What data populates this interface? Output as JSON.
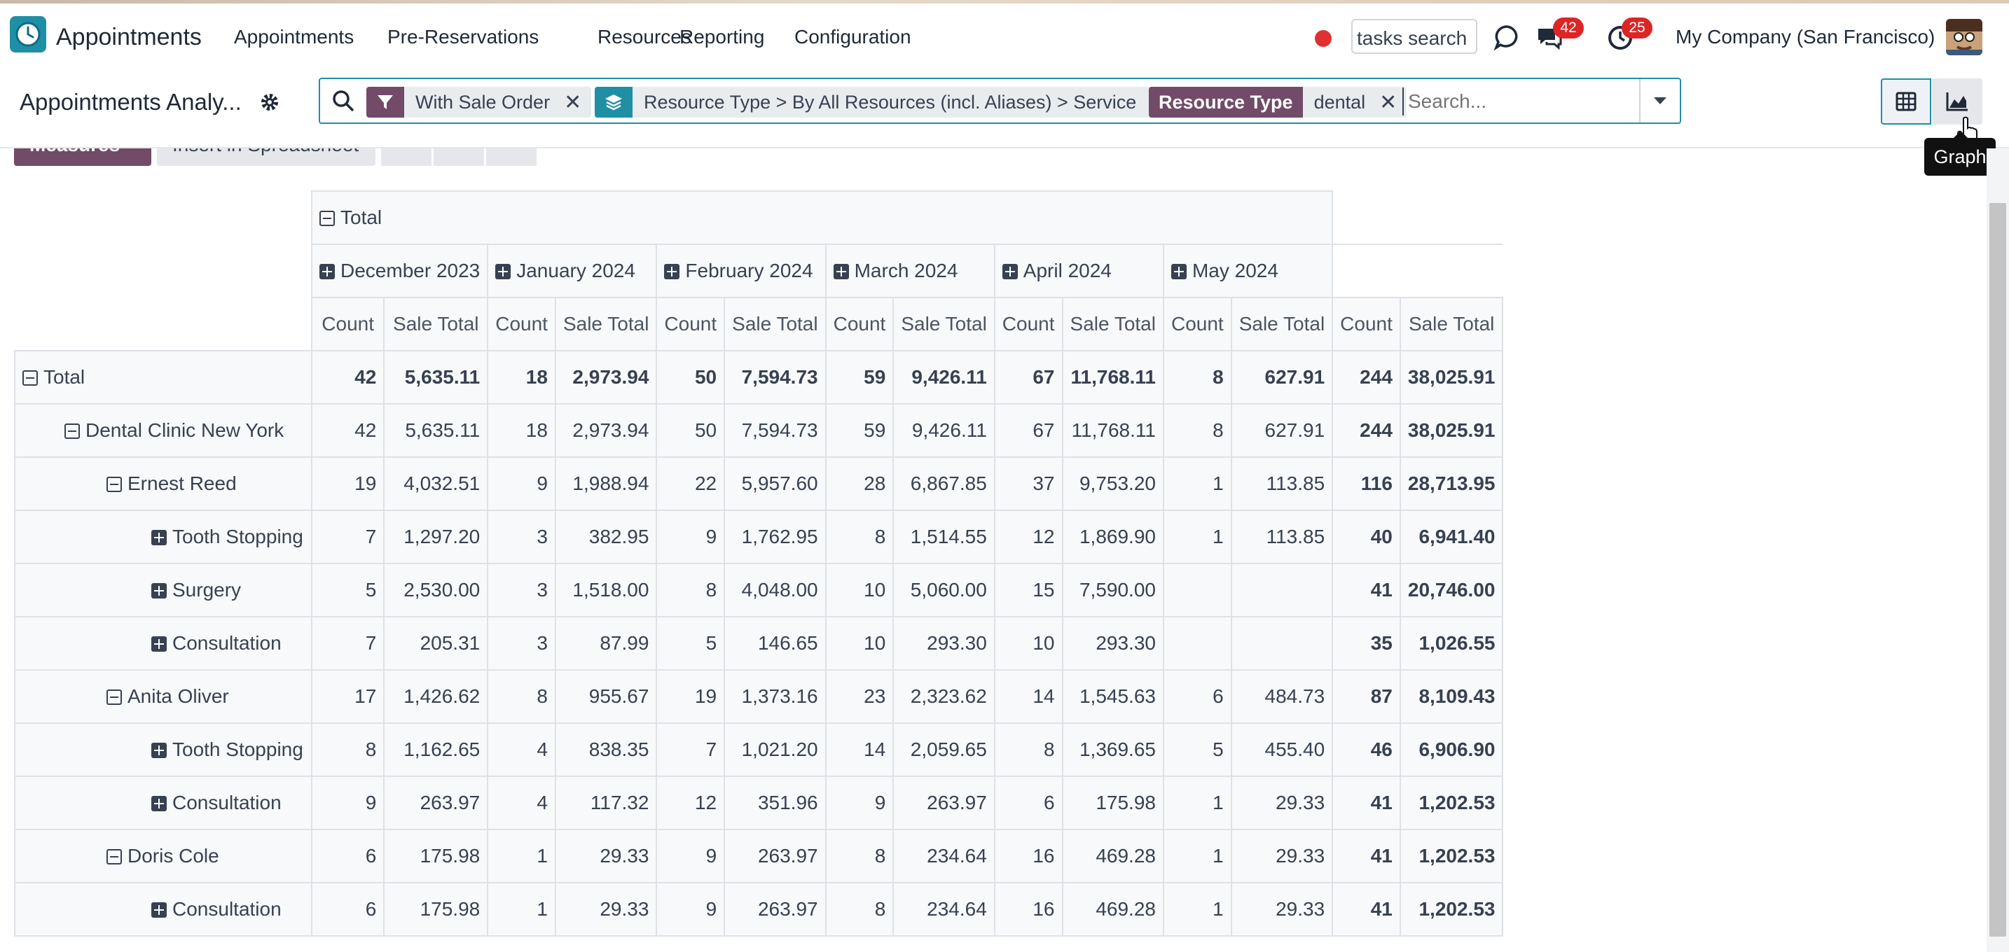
{
  "navbar": {
    "app_title": "Appointments",
    "menu": [
      "Appointments",
      "Pre-Reservations",
      "Resources",
      "Reporting",
      "Configuration"
    ],
    "task_search": "tasks search",
    "messages_count": "42",
    "activities_count": "25",
    "company": "My Company (San Francisco)"
  },
  "control_panel": {
    "breadcrumb": "Appointments Analy...",
    "facets": {
      "filter_value": "With Sale Order",
      "groupby_value": "Resource Type > By All Resources (incl. Aliases) > Service",
      "field_label": "Resource Type",
      "field_value": "dental"
    },
    "search_placeholder": "Search...",
    "tooltip": "Graph"
  },
  "toolbar": {
    "measures": "Measures",
    "insert": "Insert in Spreadsheet"
  },
  "pivot": {
    "col_total": "Total",
    "months": [
      "December 2023",
      "January 2024",
      "February 2024",
      "March 2024",
      "April 2024",
      "May 2024"
    ],
    "measure_labels": [
      "Count",
      "Sale Total"
    ],
    "rows": [
      {
        "label": "Total",
        "level": 0,
        "toggle": "minus",
        "values": [
          "42",
          "5,635.11",
          "18",
          "2,973.94",
          "50",
          "7,594.73",
          "59",
          "9,426.11",
          "67",
          "11,768.11",
          "8",
          "627.91",
          "244",
          "38,025.91"
        ]
      },
      {
        "label": "Dental Clinic New York",
        "level": 1,
        "toggle": "minus",
        "values": [
          "42",
          "5,635.11",
          "18",
          "2,973.94",
          "50",
          "7,594.73",
          "59",
          "9,426.11",
          "67",
          "11,768.11",
          "8",
          "627.91",
          "244",
          "38,025.91"
        ]
      },
      {
        "label": "Ernest Reed",
        "level": 2,
        "toggle": "minus",
        "values": [
          "19",
          "4,032.51",
          "9",
          "1,988.94",
          "22",
          "5,957.60",
          "28",
          "6,867.85",
          "37",
          "9,753.20",
          "1",
          "113.85",
          "116",
          "28,713.95"
        ]
      },
      {
        "label": "Tooth Stopping",
        "level": 3,
        "toggle": "plus",
        "values": [
          "7",
          "1,297.20",
          "3",
          "382.95",
          "9",
          "1,762.95",
          "8",
          "1,514.55",
          "12",
          "1,869.90",
          "1",
          "113.85",
          "40",
          "6,941.40"
        ]
      },
      {
        "label": "Surgery",
        "level": 3,
        "toggle": "plus",
        "values": [
          "5",
          "2,530.00",
          "3",
          "1,518.00",
          "8",
          "4,048.00",
          "10",
          "5,060.00",
          "15",
          "7,590.00",
          "",
          "",
          "41",
          "20,746.00"
        ]
      },
      {
        "label": "Consultation",
        "level": 3,
        "toggle": "plus",
        "values": [
          "7",
          "205.31",
          "3",
          "87.99",
          "5",
          "146.65",
          "10",
          "293.30",
          "10",
          "293.30",
          "",
          "",
          "35",
          "1,026.55"
        ]
      },
      {
        "label": "Anita Oliver",
        "level": 2,
        "toggle": "minus",
        "values": [
          "17",
          "1,426.62",
          "8",
          "955.67",
          "19",
          "1,373.16",
          "23",
          "2,323.62",
          "14",
          "1,545.63",
          "6",
          "484.73",
          "87",
          "8,109.43"
        ]
      },
      {
        "label": "Tooth Stopping",
        "level": 3,
        "toggle": "plus",
        "values": [
          "8",
          "1,162.65",
          "4",
          "838.35",
          "7",
          "1,021.20",
          "14",
          "2,059.65",
          "8",
          "1,369.65",
          "5",
          "455.40",
          "46",
          "6,906.90"
        ]
      },
      {
        "label": "Consultation",
        "level": 3,
        "toggle": "plus",
        "values": [
          "9",
          "263.97",
          "4",
          "117.32",
          "12",
          "351.96",
          "9",
          "263.97",
          "6",
          "175.98",
          "1",
          "29.33",
          "41",
          "1,202.53"
        ]
      },
      {
        "label": "Doris Cole",
        "level": 2,
        "toggle": "minus",
        "values": [
          "6",
          "175.98",
          "1",
          "29.33",
          "9",
          "263.97",
          "8",
          "234.64",
          "16",
          "469.28",
          "1",
          "29.33",
          "41",
          "1,202.53"
        ]
      },
      {
        "label": "Consultation",
        "level": 3,
        "toggle": "plus",
        "values": [
          "6",
          "175.98",
          "1",
          "29.33",
          "9",
          "263.97",
          "8",
          "234.64",
          "16",
          "469.28",
          "1",
          "29.33",
          "41",
          "1,202.53"
        ]
      }
    ]
  }
}
